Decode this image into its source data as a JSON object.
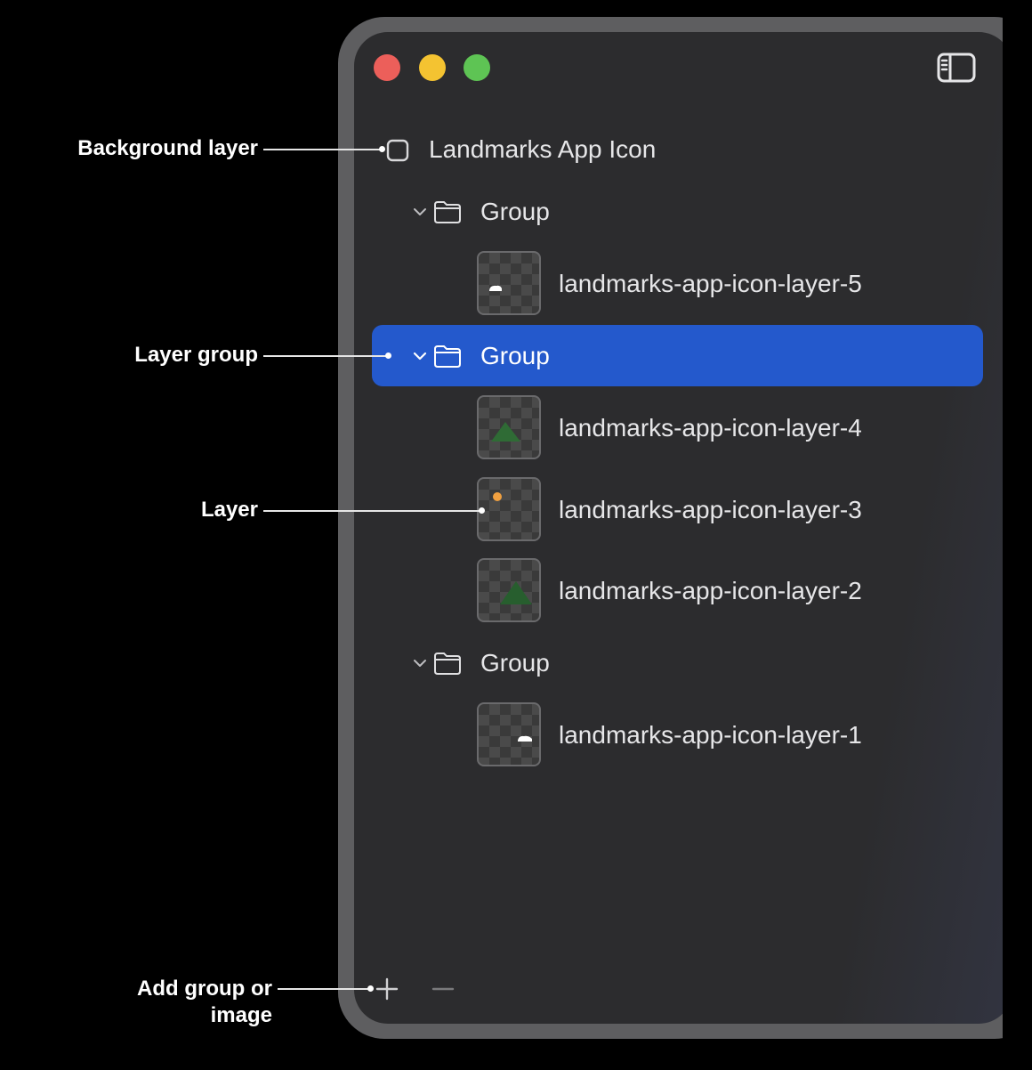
{
  "window": {
    "traffic_lights": [
      "close",
      "minimize",
      "zoom"
    ],
    "toolbar": {
      "sidebar_toggle_icon": "sidebar-left-icon"
    }
  },
  "tree": {
    "root": {
      "label": "Landmarks App Icon",
      "icon": "square-icon"
    },
    "groups": [
      {
        "label": "Group",
        "selected": false,
        "layers": [
          {
            "label": "landmarks-app-icon-layer-5",
            "thumb": "cloud"
          }
        ]
      },
      {
        "label": "Group",
        "selected": true,
        "layers": [
          {
            "label": "landmarks-app-icon-layer-4",
            "thumb": "green-mountain"
          },
          {
            "label": "landmarks-app-icon-layer-3",
            "thumb": "orange-dot"
          },
          {
            "label": "landmarks-app-icon-layer-2",
            "thumb": "dark-green-mountain"
          }
        ]
      },
      {
        "label": "Group",
        "selected": false,
        "layers": [
          {
            "label": "landmarks-app-icon-layer-1",
            "thumb": "cloud"
          }
        ]
      }
    ]
  },
  "bottom_bar": {
    "add_icon": "plus-icon",
    "remove_icon": "minus-icon"
  },
  "annotations": {
    "background_layer": "Background layer",
    "layer_group": "Layer group",
    "layer": "Layer",
    "add_line1": "Add group or",
    "add_line2": "image"
  },
  "colors": {
    "selection": "#2459cc",
    "window_bg": "#2c2c2e",
    "close": "#ec5f5a",
    "minimize": "#f4c331",
    "zoom": "#5ec454",
    "mountain_green": "#2f6b35",
    "mountain_dark_green": "#275e2e",
    "sun_orange": "#f0a040"
  }
}
